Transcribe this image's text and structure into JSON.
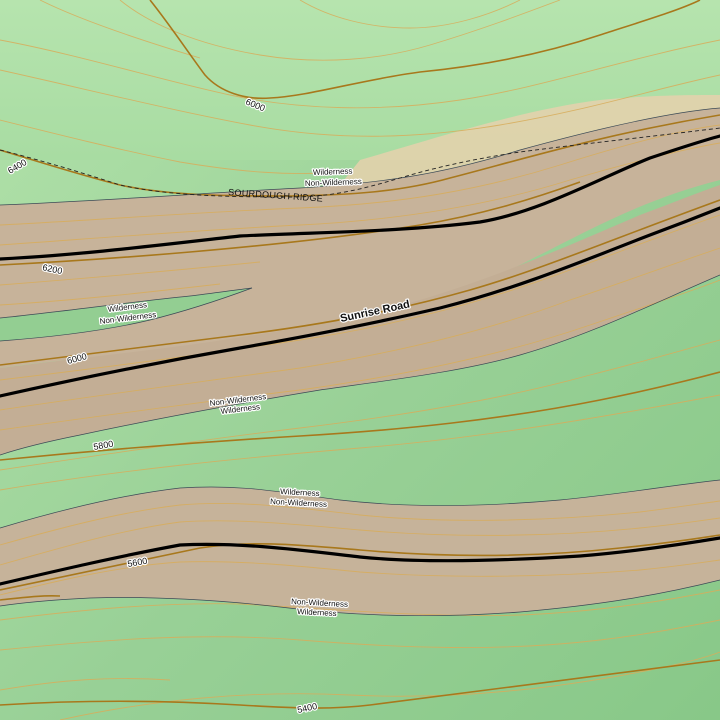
{
  "map": {
    "road_name": "Sunrise Road",
    "ridge_name": "SOURDOUGH RIDGE",
    "boundary_labels": {
      "wilderness": "Wilderness",
      "non_wilderness": "Non-Wilderness"
    },
    "contour_labels": [
      "6400",
      "6000",
      "6200",
      "6000",
      "5800",
      "5600",
      "5400"
    ],
    "colors": {
      "wilderness_light": "#aee0a6",
      "wilderness_dark": "#8fcc8f",
      "corridor": "#c6b39b",
      "sand": "#e8d3b0",
      "contour_index": "#a8781c",
      "contour_minor": "#d4aa55",
      "road": "#000000",
      "boundary": "#3a4a55"
    }
  }
}
